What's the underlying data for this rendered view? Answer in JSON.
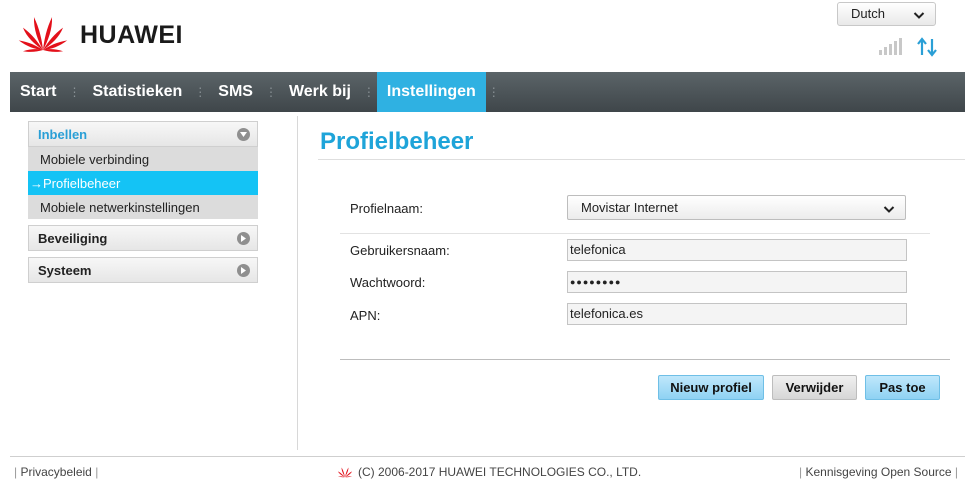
{
  "brand": {
    "name": "HUAWEI"
  },
  "header": {
    "language": "Dutch",
    "colors": {
      "accent": "#1ea4d9",
      "nav_active": "#2fb1e2",
      "sidebar_active": "#14c3f5"
    }
  },
  "nav": {
    "items": [
      {
        "label": "Start"
      },
      {
        "label": "Statistieken"
      },
      {
        "label": "SMS"
      },
      {
        "label": "Werk bij"
      },
      {
        "label": "Instellingen"
      }
    ]
  },
  "sidebar": {
    "groups": [
      {
        "label": "Inbellen",
        "items": [
          {
            "label": "Mobiele verbinding"
          },
          {
            "label": "Profielbeheer",
            "arrow": "→"
          },
          {
            "label": "Mobiele netwerkinstellingen"
          }
        ]
      },
      {
        "label": "Beveiliging"
      },
      {
        "label": "Systeem"
      }
    ]
  },
  "main": {
    "title": "Profielbeheer",
    "form": {
      "profile_label": "Profielnaam:",
      "profile_value": "Movistar Internet",
      "username_label": "Gebruikersnaam:",
      "username_value": "telefonica",
      "password_label": "Wachtwoord:",
      "password_value": "●●●●●●●●",
      "apn_label": "APN:",
      "apn_value": "telefonica.es"
    },
    "buttons": {
      "new_profile": "Nieuw profiel",
      "delete": "Verwijder",
      "apply": "Pas toe"
    }
  },
  "footer": {
    "privacy": "Privacybeleid",
    "copyright": "(C) 2006-2017 HUAWEI TECHNOLOGIES CO., LTD.",
    "open_source": "Kennisgeving Open Source"
  }
}
